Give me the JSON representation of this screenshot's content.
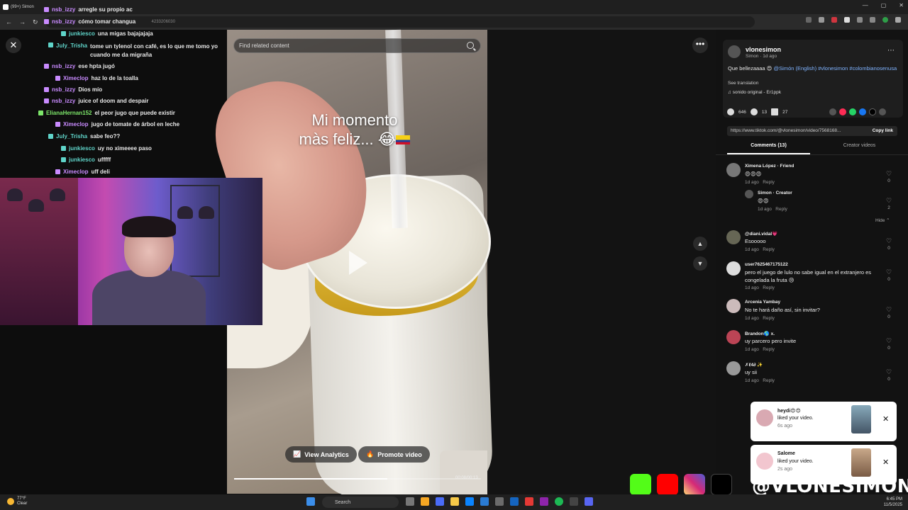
{
  "browser": {
    "tab_title": "(99+) Simon",
    "url": "4233206030"
  },
  "chat": {
    "messages": [
      {
        "user": "nsb_izzy",
        "color": "#c98bff",
        "text": "arregle su propio ac"
      },
      {
        "user": "nsb_izzy",
        "color": "#c98bff",
        "text": "cómo tomar changua"
      },
      {
        "user": "junkiesco",
        "color": "#5fd4c9",
        "text": "una migas bajajajaja"
      },
      {
        "user": "July_Trisha",
        "color": "#5fd4c9",
        "text": "tome un tylenol con café, es lo que me tomo yo cuando me da migraña"
      },
      {
        "user": "nsb_izzy",
        "color": "#c98bff",
        "text": "ese hpta jugó"
      },
      {
        "user": "Ximeclop",
        "color": "#c98bff",
        "text": "haz lo de la toalla"
      },
      {
        "user": "nsb_izzy",
        "color": "#c98bff",
        "text": "Dios mío"
      },
      {
        "user": "nsb_izzy",
        "color": "#c98bff",
        "text": "juice of doom and despair"
      },
      {
        "user": "ElianaHernan152",
        "color": "#7de66a",
        "text": "el peor jugo que puede existir"
      },
      {
        "user": "Ximeclop",
        "color": "#c98bff",
        "text": "jugo de tomate de árbol en leche"
      },
      {
        "user": "July_Trisha",
        "color": "#5fd4c9",
        "text": "sabe feo??"
      },
      {
        "user": "junkiesco",
        "color": "#5fd4c9",
        "text": "uy no ximeeee paso"
      },
      {
        "user": "junkiesco",
        "color": "#5fd4c9",
        "text": "ufffff"
      },
      {
        "user": "Ximeclop",
        "color": "#c98bff",
        "text": "uff deli"
      }
    ]
  },
  "video": {
    "search_placeholder": "Find related content",
    "overlay_line1": "Mi momento",
    "overlay_line2": "màs feliz... 😂",
    "view_analytics": "View Analytics",
    "promote_video": "Promote video",
    "time": "00:08/00:13",
    "progress": 0.62
  },
  "panel": {
    "author": "vlonesimon",
    "author_sub": "Simon · 1d ago",
    "caption_text": "Que bellezaaaa 😍",
    "caption_mention": "@Simón (English)",
    "caption_tag1": "#vlonesimon",
    "caption_tag2": "#colombianosenusa",
    "see_translation": "See translation",
    "sound": "sonido original - Er1ppk",
    "likes": "646",
    "comments_count": "13",
    "saves": "27",
    "link": "https://www.tiktok.com/@vlonesimon/video/7568168...",
    "copy_link": "Copy link",
    "tab_comments": "Comments (13)",
    "tab_creator": "Creator videos",
    "hide": "Hide",
    "comments": [
      {
        "user": "Ximena López · Friend",
        "text": "😍😍😍",
        "meta": "1d ago   Reply",
        "likes": "0"
      },
      {
        "user": "Simon · Creator",
        "text": "😍😍",
        "meta": "1d ago   Reply",
        "likes": "2"
      },
      {
        "user": "@diani.vidal💗",
        "text": "Esooooo",
        "meta": "1d ago   Reply",
        "likes": "0"
      },
      {
        "user": "user7625467175122",
        "text": "pero el juego de lulo no sabe igual en el extranjero es congelada la fruta 😢",
        "meta": "1d ago   Reply",
        "likes": "0"
      },
      {
        "user": "Arcenia Yambay",
        "text": "No te hará daño así, sin invitar?",
        "meta": "1d ago   Reply",
        "likes": "0"
      },
      {
        "user": "Brandon🌎 x.",
        "text": "uy parcero pero invite",
        "meta": "1d ago   Reply",
        "likes": "0"
      },
      {
        "user": "✗ℓ4∂ ✨",
        "text": "uy sii",
        "meta": "1d ago   Reply",
        "likes": "0"
      }
    ]
  },
  "toasts": [
    {
      "user": "heydi😍😍",
      "text": "liked your video.",
      "ago": "6s ago"
    },
    {
      "user": "Salome",
      "text": "liked your video.",
      "ago": "2s ago"
    }
  ],
  "stream": {
    "handle": "@VLONESIMON"
  },
  "taskbar": {
    "temp": "77°F",
    "weather": "Clear",
    "search": "Search",
    "time": "6:45 PM",
    "date": "11/5/2025"
  }
}
